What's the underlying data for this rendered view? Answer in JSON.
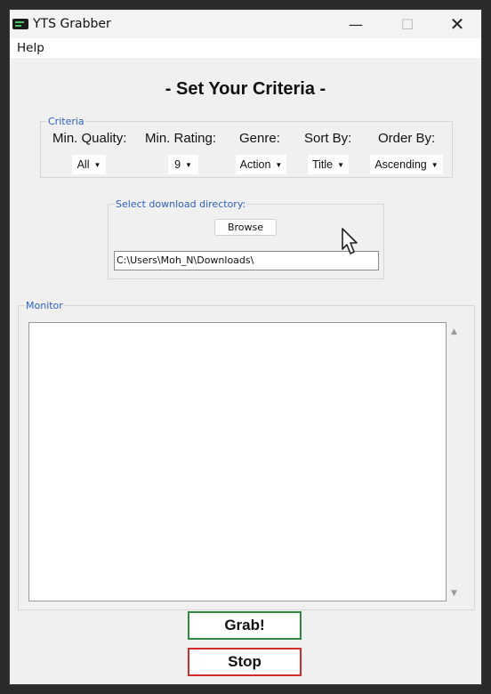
{
  "window": {
    "title": "YTS Grabber"
  },
  "window_controls": {
    "minimize": "—",
    "maximize": "☐",
    "close": "✕"
  },
  "menubar": {
    "items": [
      "Help"
    ]
  },
  "heading": "- Set Your Criteria -",
  "criteria": {
    "group_label": "Criteria",
    "fields": [
      {
        "label": "Min. Quality:",
        "value": "All"
      },
      {
        "label": "Min. Rating:",
        "value": "9"
      },
      {
        "label": "Genre:",
        "value": "Action"
      },
      {
        "label": "Sort By:",
        "value": "Title"
      },
      {
        "label": "Order By:",
        "value": "Ascending"
      }
    ]
  },
  "directory": {
    "group_label": "Select download directory:",
    "browse_label": "Browse",
    "path_value": "C:\\Users\\Moh_N\\Downloads\\"
  },
  "monitor": {
    "group_label": "Monitor",
    "text": ""
  },
  "actions": {
    "grab_label": "Grab!",
    "stop_label": "Stop"
  },
  "colors": {
    "group_label_blue": "#2b5fbe",
    "grab_border": "#2e8a3e",
    "stop_border": "#d12c2c"
  }
}
